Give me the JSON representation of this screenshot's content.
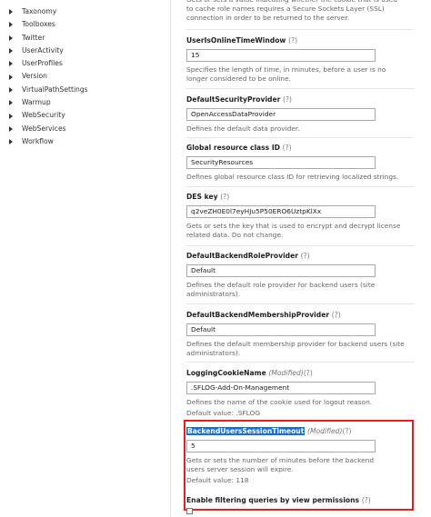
{
  "sidebar": {
    "items": [
      "Taxonomy",
      "Toolboxes",
      "Twitter",
      "UserActivity",
      "UserProfiles",
      "Version",
      "VirtualPathSettings",
      "Warmup",
      "WebSecurity",
      "WebServices",
      "Workflow"
    ]
  },
  "top_desc": "Gets or sets a value indicating whether the cookie that is used to cache role names requires a Secure Sockets Layer (SSL) connection in order to be returned to the server.",
  "settings": [
    {
      "label": "UserIsOnlineTimeWindow",
      "help": "(?)",
      "value": "15",
      "desc": "Specifies the length of time, in minutes, before a user is no longer considered to be online."
    },
    {
      "label": "DefaultSecurityProvider",
      "help": "(?)",
      "value": "OpenAccessDataProvider",
      "desc": "Defines the default data provider."
    },
    {
      "label": "Global resource class ID",
      "help": "(?)",
      "value": "SecurityResources",
      "desc": "Defines global resource class ID for retrieving localized strings."
    },
    {
      "label": "DES key",
      "help": "(?)",
      "value": "q2veZH0E0l7eyHJu5P50ERO6UztpKlXx",
      "desc": "Gets or sets the key that is used to encrypt and decrypt license related data. Do not change."
    },
    {
      "label": "DefaultBackendRoleProvider",
      "help": "(?)",
      "value": "Default",
      "desc": "Defines the default role provider for backend users (site administrators)."
    },
    {
      "label": "DefaultBackendMembershipProvider",
      "help": "(?)",
      "value": "Default",
      "desc": "Defines the default membership provider for backend users (site administrators)."
    },
    {
      "label": "LoggingCookieName",
      "modified": "(Modified)",
      "help": "(?)",
      "value": ".SFLOG-Add-On-Management",
      "desc": "Defines the name of the cookie used for logout reason.",
      "default": "Default value: .SFLOG"
    },
    {
      "label": "BackendUsersSessionTimeout",
      "modified": "(Modified)",
      "help": "(?)",
      "value": "5",
      "desc": "Gets or sets the number of minutes before the backend users server session will expire.",
      "default": "Default value: 118"
    }
  ],
  "filter": {
    "label": "Enable filtering queries by view permissions",
    "help": "(?)"
  },
  "colors": {
    "highlight_border": "#e02020",
    "selection_bg": "#1e6ec8"
  }
}
